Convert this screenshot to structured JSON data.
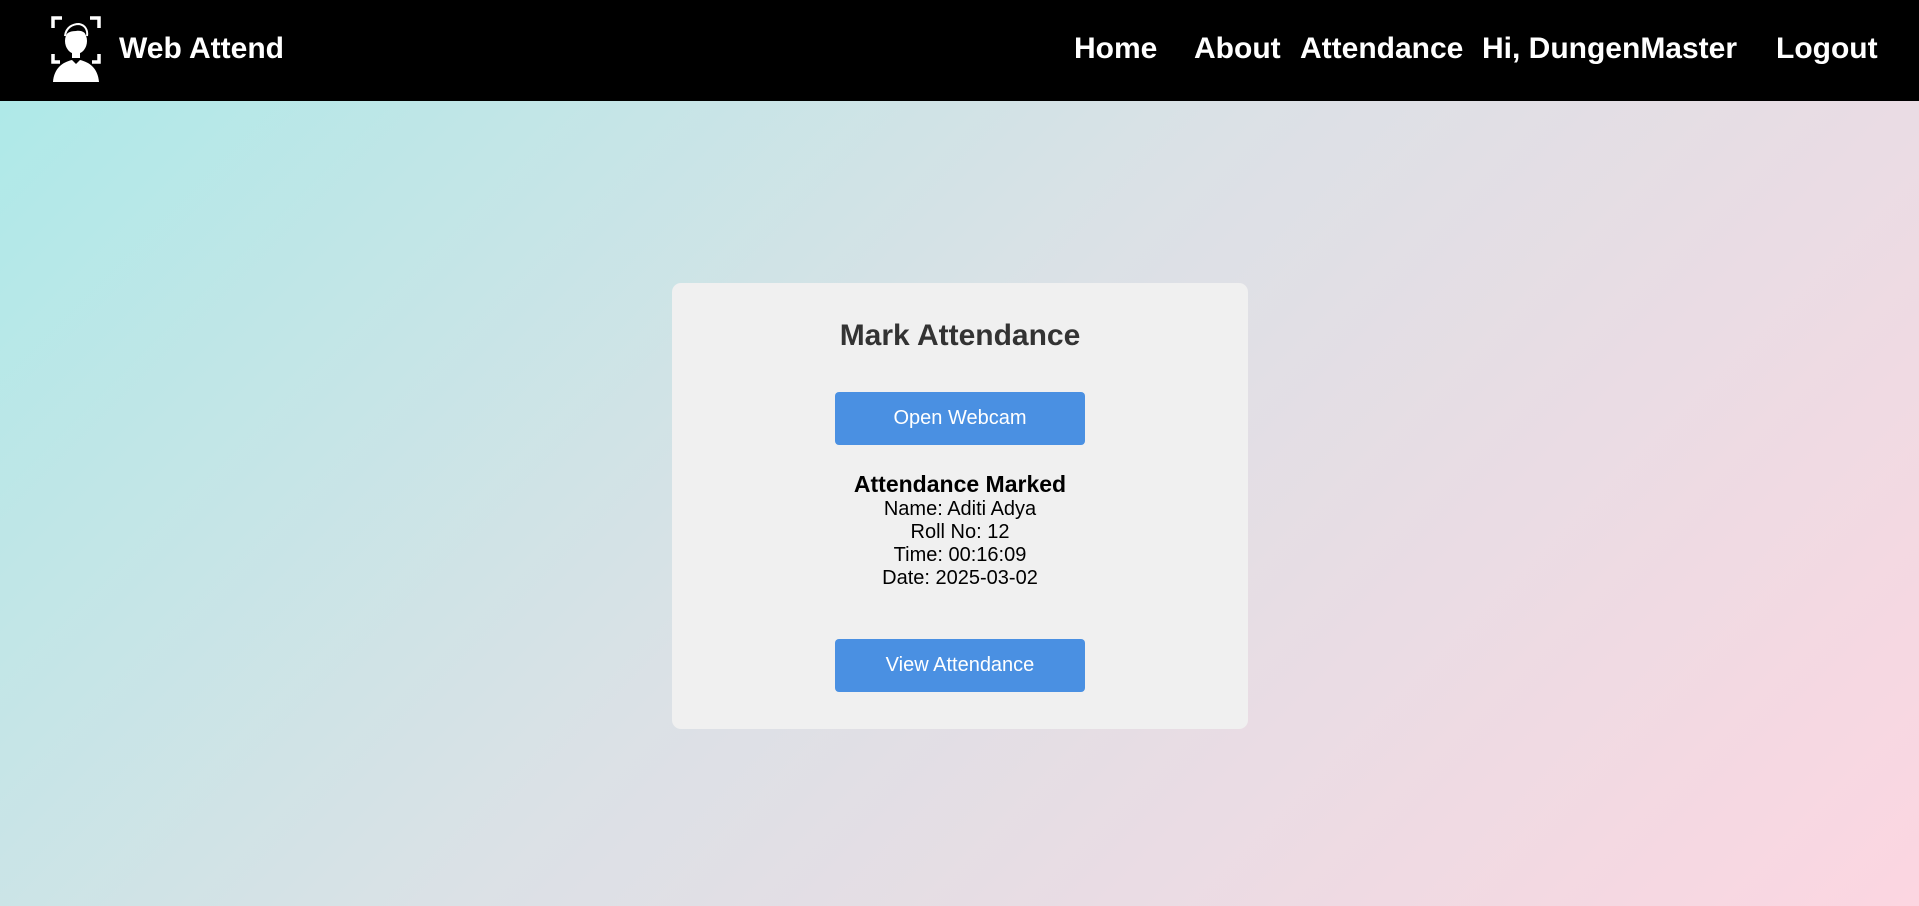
{
  "navbar": {
    "brand_icon": "face-scan-icon",
    "brand_name": "Web Attend",
    "links": {
      "home": "Home",
      "about": "About",
      "attendance": "Attendance",
      "greeting": "Hi, DungenMaster",
      "logout": "Logout"
    }
  },
  "card": {
    "title": "Mark Attendance",
    "open_webcam_label": "Open Webcam",
    "result": {
      "title": "Attendance Marked",
      "name": "Name: Aditi Adya",
      "roll_no": "Roll No: 12",
      "time": "Time: 00:16:09",
      "date": "Date: 2025-03-02"
    },
    "view_attendance_label": "View Attendance"
  },
  "colors": {
    "navbar_bg": "#000000",
    "accent": "#4a90e2",
    "card_bg": "#f0f0f0",
    "gradient_start": "#abeae8",
    "gradient_end": "#fcd6e1"
  }
}
